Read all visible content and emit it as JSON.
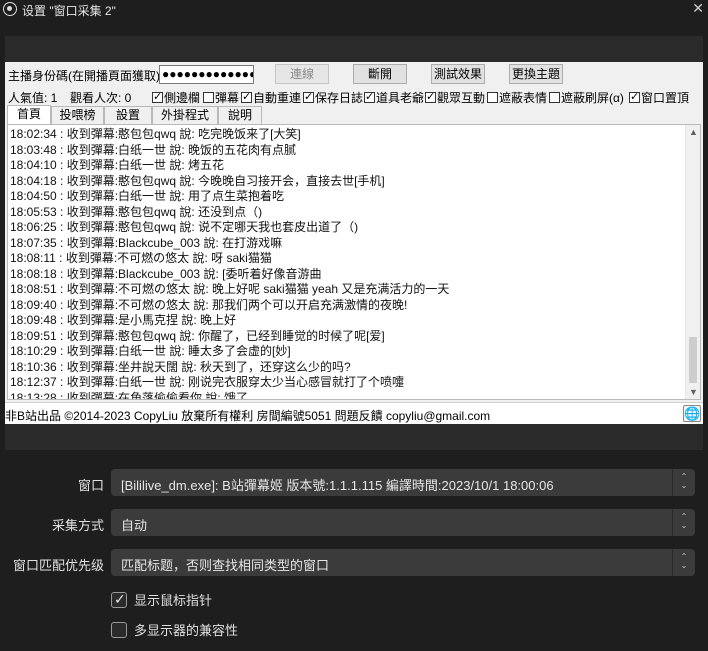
{
  "window": {
    "title": "设置 \"窗口采集 2\""
  },
  "app": {
    "anchor_label": "主播身份碼(在開播頁面獲取)",
    "anchor_code_value": "●●●●●●●●●●●●●",
    "buttons": {
      "connect": "連線",
      "disconnect": "斷開",
      "test": "測試效果",
      "theme": "更換主題"
    },
    "stats": {
      "popularity": "人氣值: 1",
      "viewers": "觀看人次: 0"
    },
    "checkboxes": [
      {
        "label": "側邊欄",
        "checked": true
      },
      {
        "label": "彈幕",
        "checked": false
      },
      {
        "label": "自動重連",
        "checked": true
      },
      {
        "label": "保存日誌",
        "checked": true
      },
      {
        "label": "道具老爺",
        "checked": true
      },
      {
        "label": "觀眾互動",
        "checked": true
      },
      {
        "label": "遮蔽表情",
        "checked": false
      },
      {
        "label": "遮蔽刷屏(α)",
        "checked": false
      },
      {
        "label": "窗口置頂",
        "checked": true
      }
    ],
    "tabs": [
      "首頁",
      "投喂榜",
      "設置",
      "外掛程式",
      "說明"
    ],
    "log_lines": [
      "18:02:34 : 收到彈幕:憨包包qwq 說: 吃完晚饭来了[大笑]",
      "18:03:48 : 收到彈幕:白纸一世 說: 晚饭的五花肉有点腻",
      "18:04:10 : 收到彈幕:白纸一世 說: 烤五花",
      "18:04:18 : 收到彈幕:憨包包qwq 說: 今晚晚自习接开会，直接去世[手机]",
      "18:04:50 : 收到彈幕:白纸一世 說: 用了点生菜抱着吃",
      "18:05:53 : 收到彈幕:憨包包qwq 說: 还没到点（)",
      "18:06:25 : 收到彈幕:憨包包qwq 說: 说不定哪天我也套皮出道了（)",
      "18:07:35 : 收到彈幕:Blackcube_003 說: 在打游戏嘛",
      "18:08:11 : 收到彈幕:不可燃の悠太 說: 呀 saki猫猫",
      "18:08:18 : 收到彈幕:Blackcube_003 說: [委听着好像音游曲",
      "18:08:51 : 收到彈幕:不可燃の悠太 說: 晚上好呢 saki猫猫 yeah 又是充满活力的一天",
      "18:09:40 : 收到彈幕:不可燃の悠太 說: 那我们两个可以开启充满激情的夜晚!",
      "18:09:48 : 收到彈幕:是小馬克捏 說: 晚上好",
      "18:09:51 : 收到彈幕:憨包包qwq 說: 你醒了，已经到睡觉的时候了呢[爱]",
      "18:10:29 : 收到彈幕:白纸一世 說: 睡太多了会虚的[妙]",
      "18:10:36 : 收到彈幕:坐井說天闊 說: 秋天到了，还穿这么少的吗?",
      "18:12:37 : 收到彈幕:白纸一世 說: 刚说完衣服穿太少当心感冒就打了个喷嚏",
      "18:13:28 : 收到彈幕:在角落偷偷看你 說: 饿了"
    ],
    "footer_text": "非B站出品 ©2014-2023 CopyLiu 放棄所有權利 房間編號5051 問題反饋 copyliu@gmail.com"
  },
  "properties": {
    "window_label": "窗口",
    "window_value": "[Bililive_dm.exe]: B站彈幕姬  版本號:1.1.1.115  編譯時間:2023/10/1 18:00:06",
    "capture_method_label": "采集方式",
    "capture_method_value": "自动",
    "match_priority_label": "窗口匹配优先级",
    "match_priority_value": "匹配标题，否则查找相同类型的窗口",
    "show_cursor_label": "显示鼠标指针",
    "show_cursor_checked": true,
    "multi_adapter_label": "多显示器的兼容性",
    "multi_adapter_checked": false
  }
}
